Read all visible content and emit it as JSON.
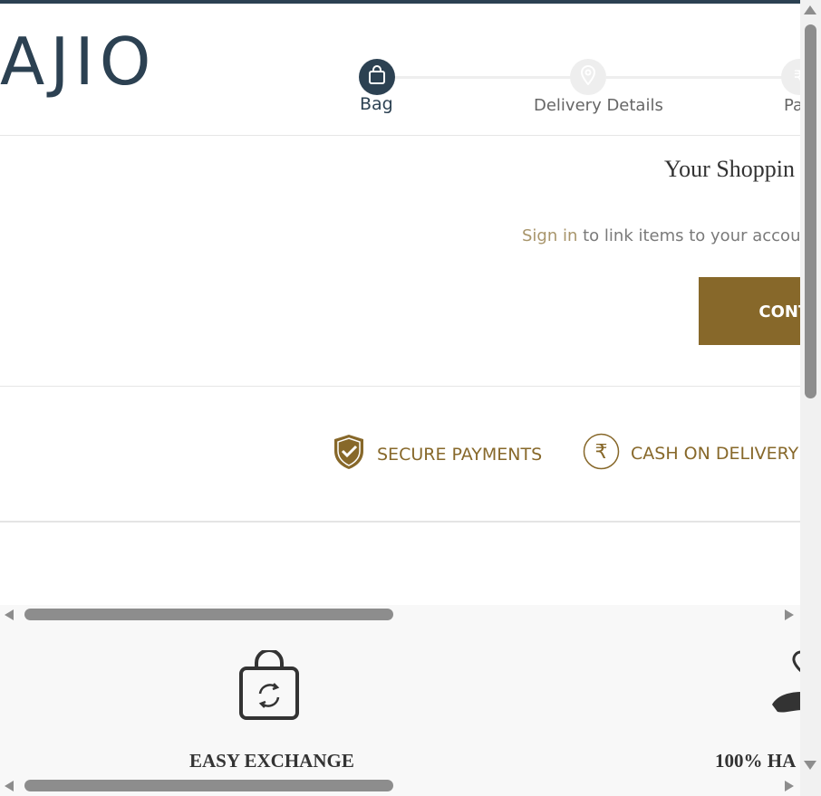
{
  "brand": {
    "logo_text": "AJIO"
  },
  "steps": [
    {
      "label": "Bag",
      "icon": "bag-icon",
      "state": "active"
    },
    {
      "label": "Delivery Details",
      "icon": "location-pin-icon",
      "state": "inactive"
    },
    {
      "label": "Pa",
      "icon": "rupee-icon",
      "state": "inactive"
    }
  ],
  "bag": {
    "title": "Your Shoppin",
    "signin_link": "Sign in",
    "signin_text": " to link items to your accoun",
    "continue_label": "CONTINU"
  },
  "badges": [
    {
      "label": "SECURE PAYMENTS",
      "icon": "shield-check-icon"
    },
    {
      "label": "CASH ON DELIVERY",
      "icon": "rupee-circle-icon"
    }
  ],
  "features": [
    {
      "label": "EASY EXCHANGE",
      "icon": "exchange-bag-icon"
    },
    {
      "label": "100% HA",
      "icon": "hand-heart-icon"
    }
  ],
  "colors": {
    "brand_dark": "#2c4152",
    "accent_gold": "#87682a",
    "link_gold": "#a8956b"
  }
}
